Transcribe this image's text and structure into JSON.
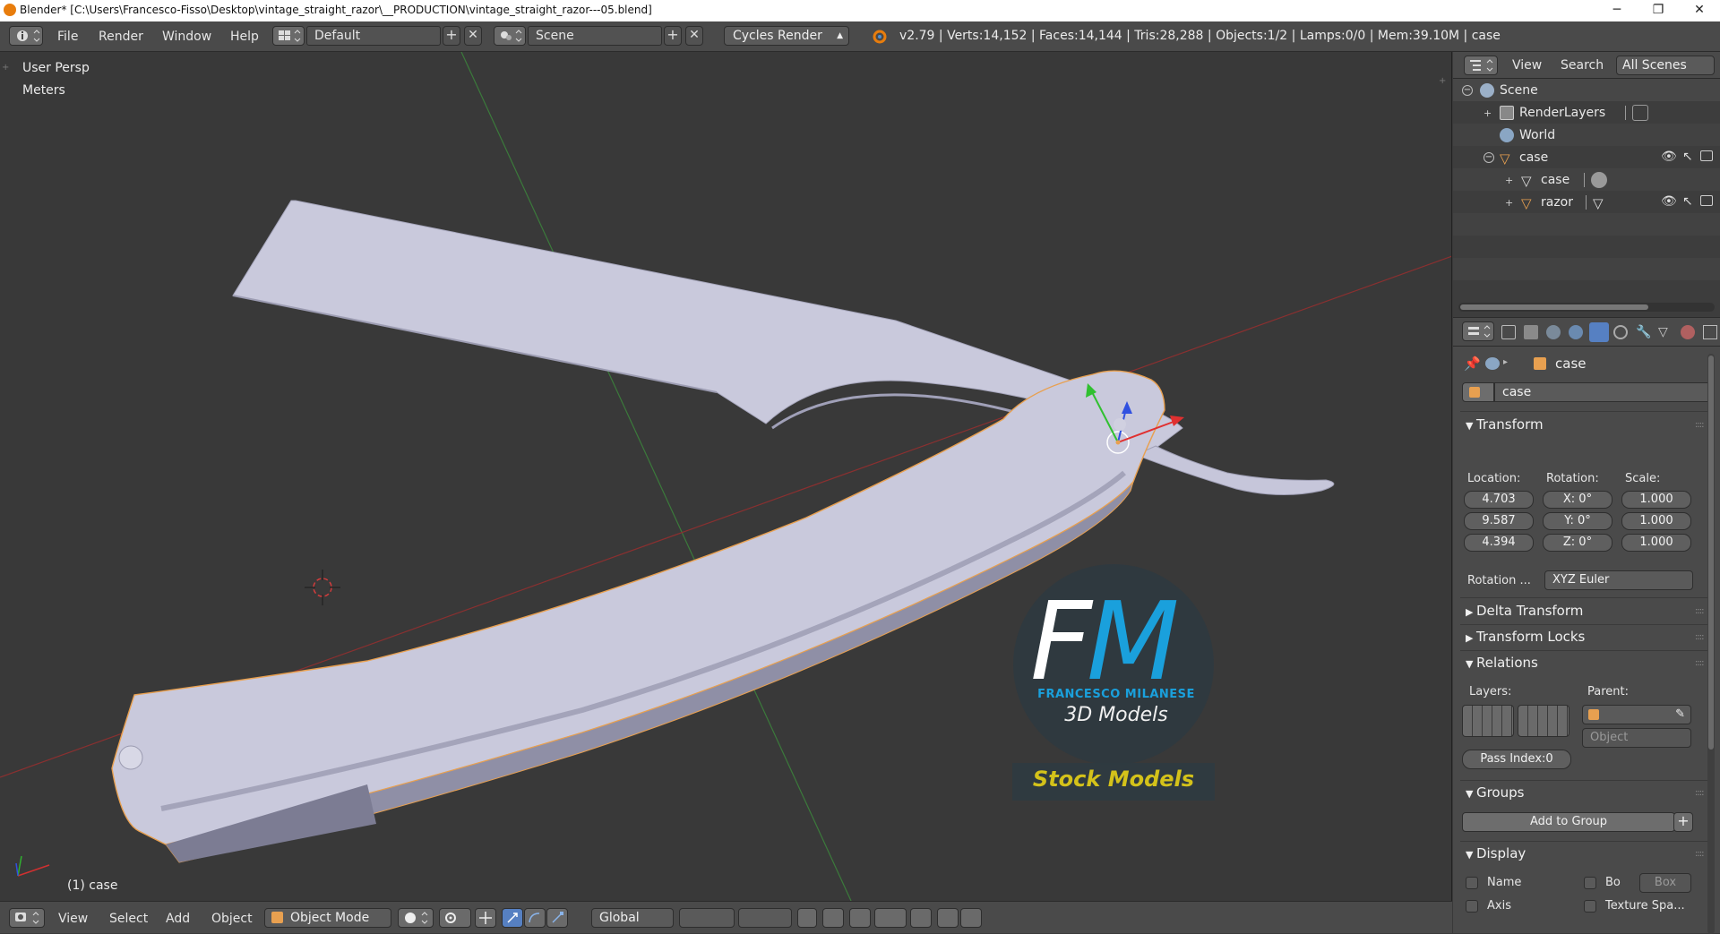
{
  "window": {
    "title": "Blender* [C:\\Users\\Francesco-Fisso\\Desktop\\vintage_straight_razor\\__PRODUCTION\\vintage_straight_razor---05.blend]",
    "minimize": "─",
    "maximize": "❐",
    "close": "✕"
  },
  "info_header": {
    "menus": [
      "File",
      "Render",
      "Window",
      "Help"
    ],
    "layout": "Default",
    "scene": "Scene",
    "engine": "Cycles Render",
    "stats": "v2.79 | Verts:14,152 | Faces:14,144 | Tris:28,288 | Objects:1/2 | Lamps:0/0 | Mem:39.10M | case"
  },
  "viewport": {
    "view_name": "User Persp",
    "units": "Meters",
    "active_object": "(1) case",
    "watermark": {
      "logo_text": "FM",
      "company": "FRANCESCO MILANESE",
      "tagline": "3D Models",
      "banner": "Stock Models"
    }
  },
  "bottom_header": {
    "menus": [
      "View",
      "Select",
      "Add",
      "Object"
    ],
    "mode": "Object Mode",
    "orientation": "Global"
  },
  "outliner": {
    "menus": [
      "View",
      "Search"
    ],
    "filter": "All Scenes",
    "items": [
      {
        "label": "Scene"
      },
      {
        "label": "RenderLayers"
      },
      {
        "label": "World"
      },
      {
        "label": "case"
      },
      {
        "label": "case"
      },
      {
        "label": "razor"
      }
    ]
  },
  "properties": {
    "breadcrumb": "case",
    "object_name": "case",
    "transform": {
      "title": "Transform",
      "location_label": "Location:",
      "rotation_label": "Rotation:",
      "scale_label": "Scale:",
      "location": [
        "4.703",
        "9.587",
        "4.394"
      ],
      "rotation": [
        "X:  0°",
        "Y:  0°",
        "Z:  0°"
      ],
      "scale": [
        "1.000",
        "1.000",
        "1.000"
      ],
      "rotation_mode_label": "Rotation ...",
      "rotation_mode": "XYZ Euler"
    },
    "delta_transform": "Delta Transform",
    "transform_locks": "Transform Locks",
    "relations": {
      "title": "Relations",
      "layers_label": "Layers:",
      "parent_label": "Parent:",
      "parent_type": "Object",
      "pass_index": "Pass Index:0"
    },
    "groups": {
      "title": "Groups",
      "add_button": "Add to Group"
    },
    "display": {
      "title": "Display",
      "name": "Name",
      "axis": "Axis",
      "bounds": "Bo",
      "bounds_type": "Box",
      "texture_space": "Texture Spa..."
    }
  },
  "colors": {
    "background": "#393939",
    "header": "#4a4a4a",
    "model": "#c9c9dc",
    "selection_outline": "#e8a050",
    "axis_red": "#a83232",
    "axis_green": "#3b8a3b",
    "logo_blue": "#1aa0dc",
    "banner_yellow": "#d4c21a"
  }
}
